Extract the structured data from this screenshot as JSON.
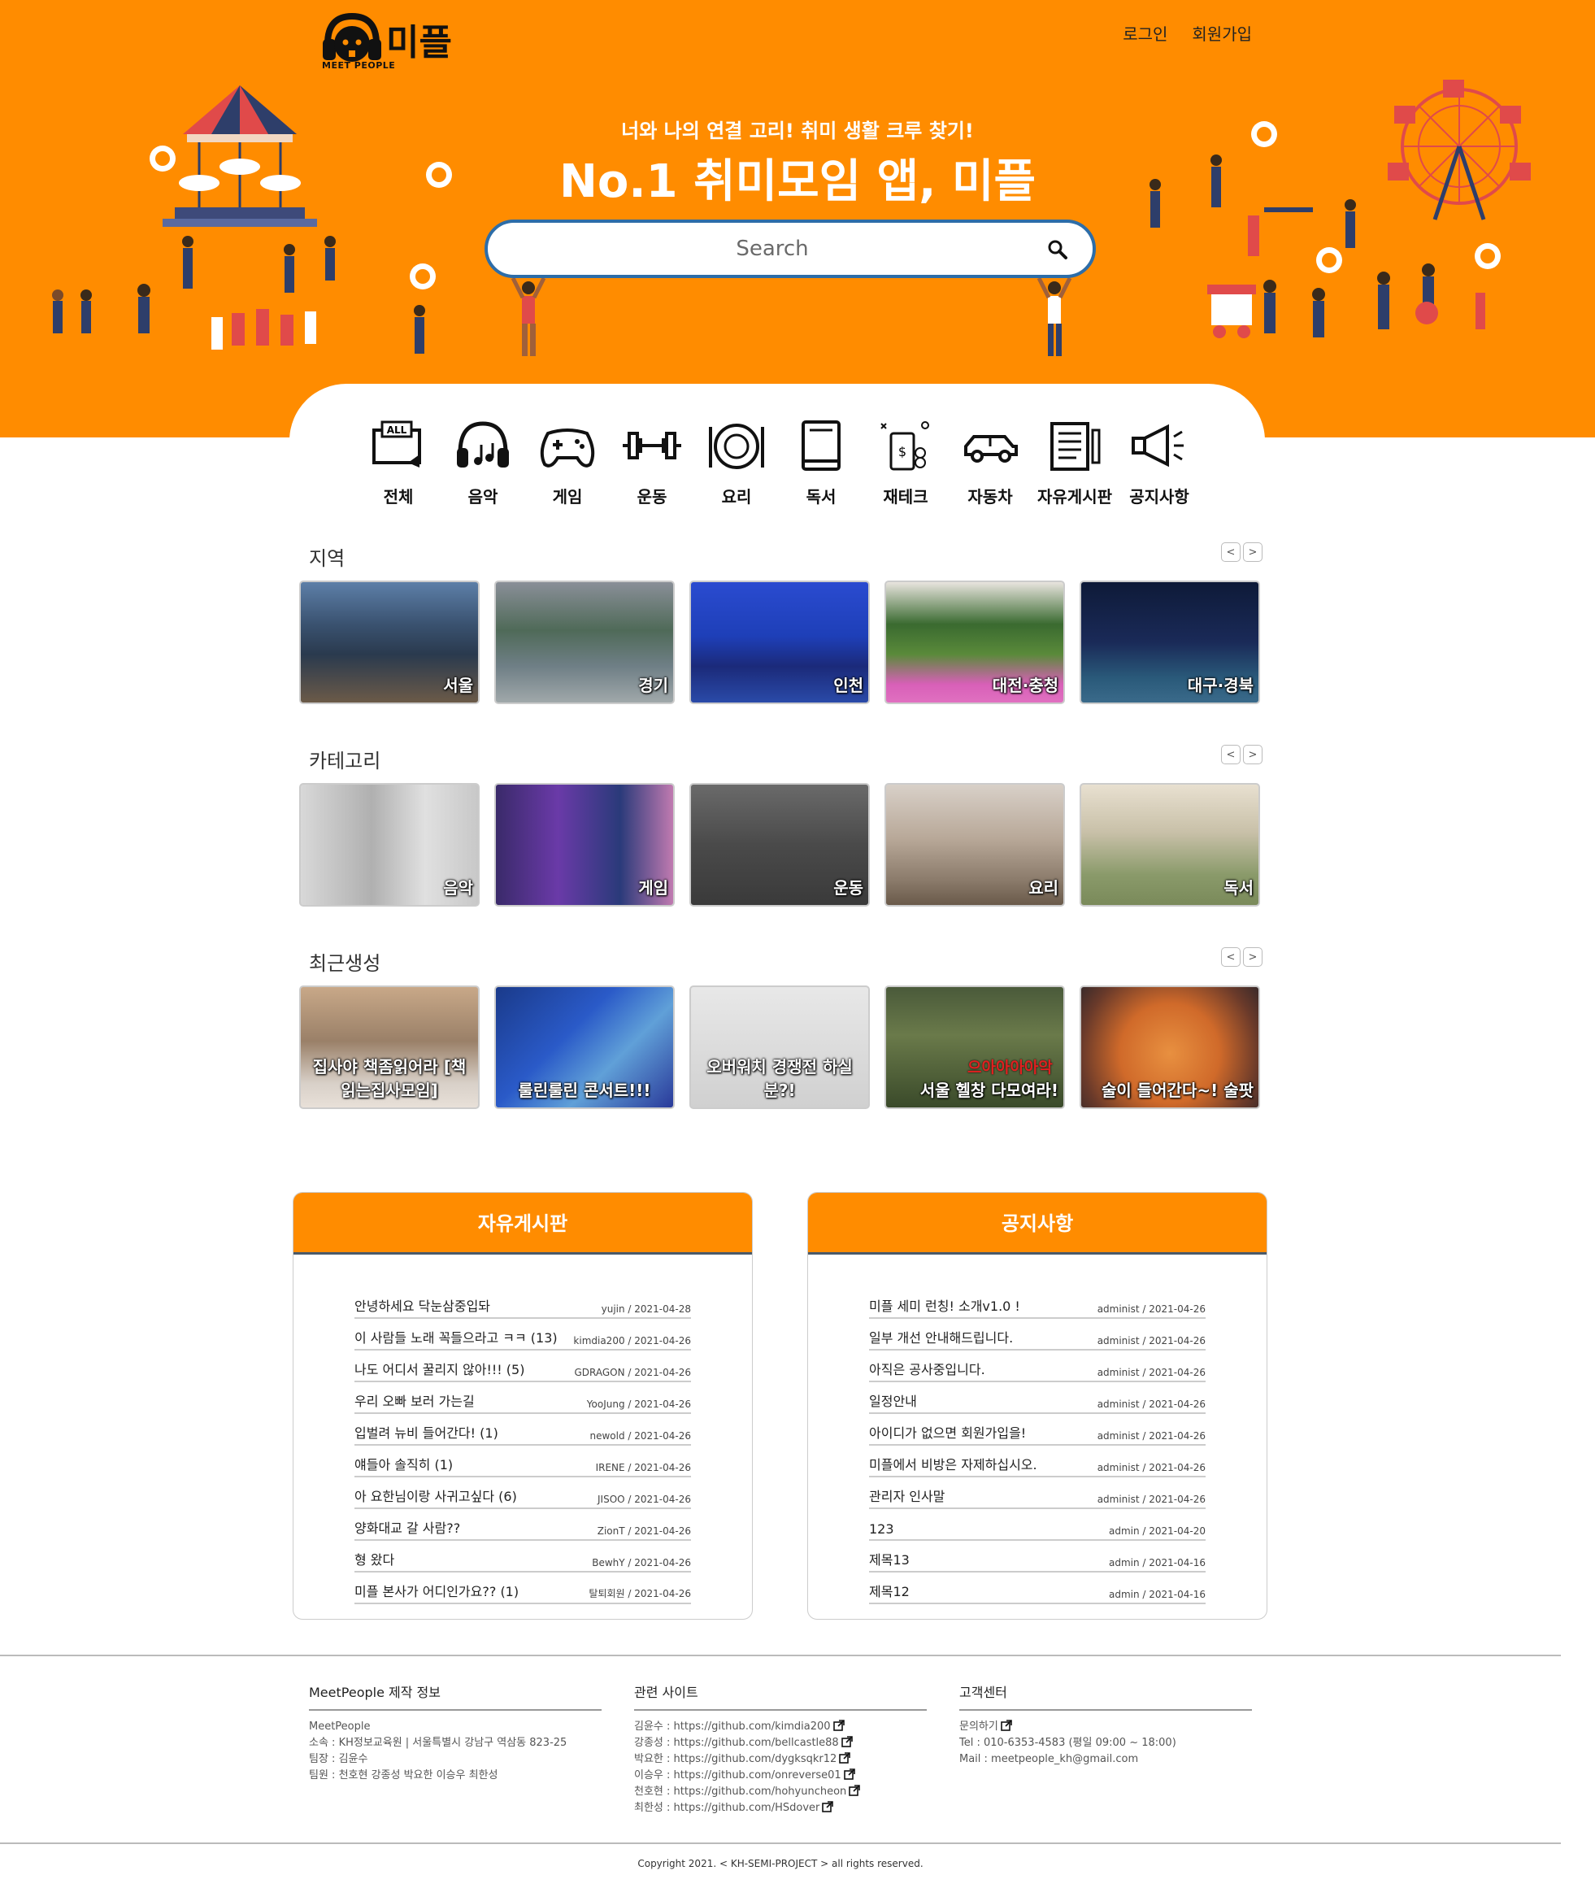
{
  "header": {
    "logo_text": "미플",
    "logo_sub": "MEET PEOPLE",
    "nav": {
      "login": "로그인",
      "signup": "회원가입"
    },
    "tagline": "너와 나의 연결 고리! 취미 생활 크루 찾기!",
    "headline": "No.1 취미모임 앱, 미플",
    "search_placeholder": "Search"
  },
  "categories": [
    {
      "label": "전체",
      "icon": "all-icon"
    },
    {
      "label": "음악",
      "icon": "headphones-icon"
    },
    {
      "label": "게임",
      "icon": "gamepad-icon"
    },
    {
      "label": "운동",
      "icon": "dumbbell-icon"
    },
    {
      "label": "요리",
      "icon": "dish-icon"
    },
    {
      "label": "독서",
      "icon": "book-icon"
    },
    {
      "label": "재테크",
      "icon": "finance-icon"
    },
    {
      "label": "자동차",
      "icon": "car-icon"
    },
    {
      "label": "자유게시판",
      "icon": "board-icon"
    },
    {
      "label": "공지사항",
      "icon": "megaphone-icon"
    }
  ],
  "sections": {
    "region": {
      "title": "지역",
      "cards": [
        "서울",
        "경기",
        "인천",
        "대전·충청",
        "대구·경북"
      ]
    },
    "category": {
      "title": "카테고리",
      "cards": [
        "음악",
        "게임",
        "운동",
        "요리",
        "독서"
      ]
    },
    "recent": {
      "title": "최근생성",
      "cards": [
        "집사야 책좀읽어라 [책읽는집사모임]",
        "룰린룰린 콘서트!!!",
        "오버워치 경쟁전 하실분?!",
        "서울 헬창 다모여라!",
        "술이 들어간다~! 술팟"
      ]
    },
    "prev": "<",
    "next": ">",
    "meme_caption": "으아아아아악"
  },
  "free_board": {
    "title": "자유게시판",
    "posts": [
      {
        "title": "안녕하세요 닥눈삼중입돠",
        "meta": "yujin / 2021-04-28"
      },
      {
        "title": "이 사람들 노래 꼭들으라고 ㅋㅋ (13)",
        "meta": "kimdia200 / 2021-04-26"
      },
      {
        "title": "나도 어디서 꿀리지 않아!!! (5)",
        "meta": "GDRAGON / 2021-04-26"
      },
      {
        "title": "우리 오빠 보러 가는길",
        "meta": "YooJung / 2021-04-26"
      },
      {
        "title": "입벌려 뉴비 들어간다! (1)",
        "meta": "newold / 2021-04-26"
      },
      {
        "title": "얘들아 솔직히 (1)",
        "meta": "IRENE / 2021-04-26"
      },
      {
        "title": "아 요한님이랑 사귀고싶다 (6)",
        "meta": "JISOO / 2021-04-26"
      },
      {
        "title": "양화대교 갈 사람??",
        "meta": "ZionT / 2021-04-26"
      },
      {
        "title": "형 왔다",
        "meta": "BewhY / 2021-04-26"
      },
      {
        "title": "미플 본사가 어디인가요?? (1)",
        "meta": "탈퇴회원 / 2021-04-26"
      }
    ]
  },
  "notice_board": {
    "title": "공지사항",
    "posts": [
      {
        "title": "미플 세미 런칭! 소개v1.0 !",
        "meta": "administ / 2021-04-26"
      },
      {
        "title": "일부 개선 안내해드립니다.",
        "meta": "administ / 2021-04-26"
      },
      {
        "title": "아직은 공사중입니다.",
        "meta": "administ / 2021-04-26"
      },
      {
        "title": "일정안내",
        "meta": "administ / 2021-04-26"
      },
      {
        "title": "아이디가 없으면 회원가입을!",
        "meta": "administ / 2021-04-26"
      },
      {
        "title": "미플에서 비방은 자제하십시오.",
        "meta": "administ / 2021-04-26"
      },
      {
        "title": "관리자 인사말",
        "meta": "administ / 2021-04-26"
      },
      {
        "title": "123",
        "meta": "admin / 2021-04-20"
      },
      {
        "title": "제목13",
        "meta": "admin / 2021-04-16"
      },
      {
        "title": "제목12",
        "meta": "admin / 2021-04-16"
      }
    ]
  },
  "footer": {
    "col1": {
      "title": "MeetPeople 제작 정보",
      "lines": [
        "MeetPeople",
        "소속 : KH정보교육원 | 서울특별시 강남구 역삼동 823-25",
        "팀장 : 김윤수",
        "팀원 : 천호현 강종성 박요한 이승우 최한성"
      ]
    },
    "col2": {
      "title": "관련 사이트",
      "lines": [
        "김윤수 : https://github.com/kimdia200",
        "강종성 : https://github.com/bellcastle88",
        "박요한 : https://github.com/dygksqkr12",
        "이승우 : https://github.com/onreverse01",
        "천호현 : https://github.com/hohyuncheon",
        "최한성 : https://github.com/HSdover"
      ]
    },
    "col3": {
      "title": "고객센터",
      "lines": [
        "문의하기",
        "Tel : 010-6353-4583 (평일 09:00 ~ 18:00)",
        "Mail : meetpeople_kh@gmail.com"
      ]
    },
    "copyright": "Copyright 2021. < KH-SEMI-PROJECT > all rights reserved."
  },
  "colors": {
    "brand_orange": "#FF8C00",
    "search_border": "#2D6DA8"
  }
}
